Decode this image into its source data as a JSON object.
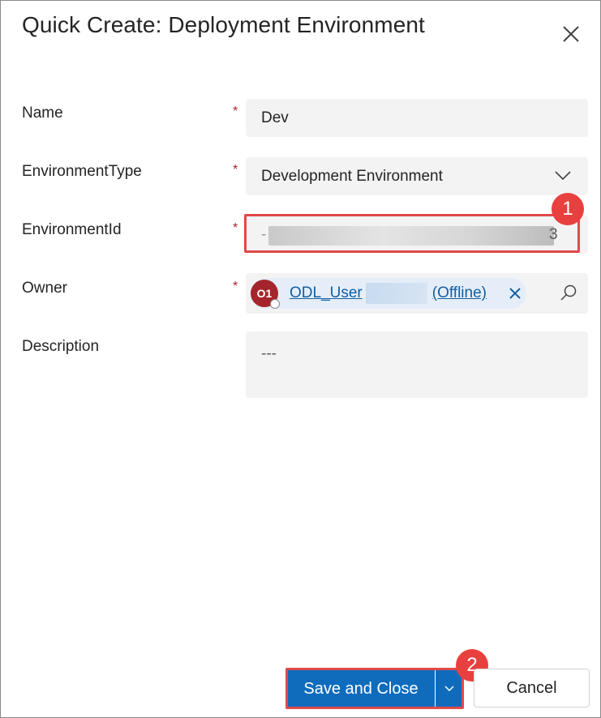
{
  "dialog": {
    "title": "Quick Create: Deployment Environment",
    "close_icon": "close-icon"
  },
  "fields": {
    "name": {
      "label": "Name",
      "required_mark": "*",
      "value": "Dev"
    },
    "environment_type": {
      "label": "EnvironmentType",
      "required_mark": "*",
      "value": "Development Environment",
      "icon": "chevron-down-icon"
    },
    "environment_id": {
      "label": "EnvironmentId",
      "required_mark": "*",
      "value_start": "-",
      "value_end": "3"
    },
    "owner": {
      "label": "Owner",
      "required_mark": "*",
      "avatar_initials": "O1",
      "avatar_color": "#a4262c",
      "user_prefix": "ODL_User",
      "user_suffix": "(Offline)",
      "remove_icon": "close-icon",
      "lookup_icon": "search-icon"
    },
    "description": {
      "label": "Description",
      "placeholder": "---"
    }
  },
  "annotations": {
    "marker_1": "1",
    "marker_2": "2",
    "color": "#e8403f"
  },
  "footer": {
    "save_label": "Save and Close",
    "split_icon": "chevron-down-icon",
    "cancel_label": "Cancel",
    "primary_color": "#0f6cbd"
  }
}
